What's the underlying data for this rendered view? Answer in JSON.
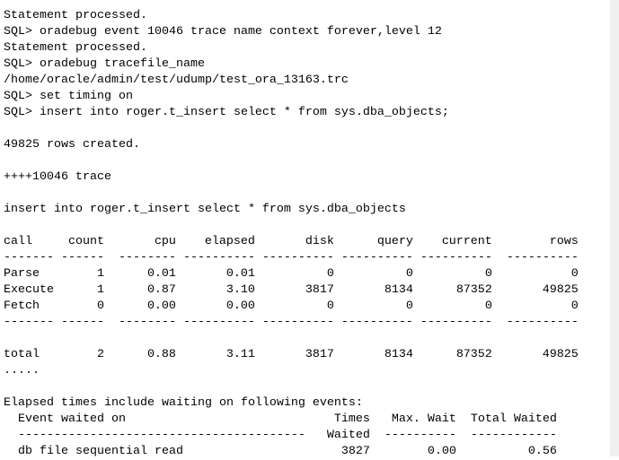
{
  "console": {
    "pre_lines": [
      "Statement processed.",
      "SQL> oradebug event 10046 trace name context forever,level 12",
      "Statement processed.",
      "SQL> oradebug tracefile_name",
      "/home/oracle/admin/test/udump/test_ora_13163.trc",
      "SQL> set timing on",
      "SQL> insert into roger.t_insert select * from sys.dba_objects;",
      "",
      "49825 rows created.",
      "",
      "++++10046 trace",
      "",
      "insert into roger.t_insert select * from sys.dba_objects",
      ""
    ],
    "table": {
      "headers": [
        "call",
        "count",
        "cpu",
        "elapsed",
        "disk",
        "query",
        "current",
        "rows"
      ],
      "separator": "------- ------  -------- ---------- ---------- ---------- ----------  ----------",
      "rows": [
        [
          "Parse",
          "1",
          "0.01",
          "0.01",
          "0",
          "0",
          "0",
          "0"
        ],
        [
          "Execute",
          "1",
          "0.87",
          "3.10",
          "3817",
          "8134",
          "87352",
          "49825"
        ],
        [
          "Fetch",
          "0",
          "0.00",
          "0.00",
          "0",
          "0",
          "0",
          "0"
        ]
      ],
      "total": [
        "total",
        "2",
        "0.88",
        "3.11",
        "3817",
        "8134",
        "87352",
        "49825"
      ]
    },
    "post_lines": [
      ".....",
      "",
      "Elapsed times include waiting on following events:",
      "  Event waited on                             Times   Max. Wait  Total Waited",
      "  ----------------------------------------   Waited  ----------  ------------",
      "  db file sequential read                      3827        0.00          0.56"
    ]
  }
}
